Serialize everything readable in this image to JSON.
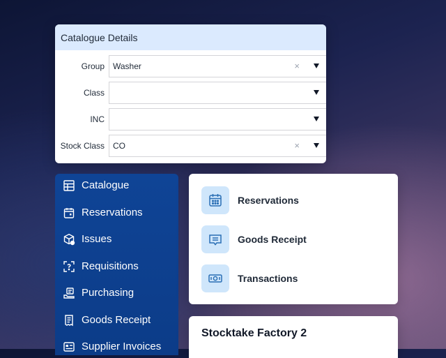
{
  "catalogue_details": {
    "title": "Catalogue Details",
    "fields": [
      {
        "label": "Group",
        "value": "Washer",
        "clearable": true
      },
      {
        "label": "Class",
        "value": "",
        "clearable": false
      },
      {
        "label": "INC",
        "value": "",
        "clearable": false
      },
      {
        "label": "Stock Class",
        "value": "CO",
        "clearable": true
      }
    ],
    "clear_glyph": "×"
  },
  "sidebar": {
    "items": [
      {
        "label": "Catalogue",
        "icon": "catalogue-icon"
      },
      {
        "label": "Reservations",
        "icon": "calendar-icon"
      },
      {
        "label": "Issues",
        "icon": "box-icon"
      },
      {
        "label": "Requisitions",
        "icon": "requisition-icon"
      },
      {
        "label": "Purchasing",
        "icon": "purchasing-icon"
      },
      {
        "label": "Goods Receipt",
        "icon": "receipt-icon"
      },
      {
        "label": "Supplier Invoices",
        "icon": "invoice-icon"
      }
    ]
  },
  "quick_links": {
    "items": [
      {
        "label": "Reservations",
        "icon": "calendar-icon"
      },
      {
        "label": "Goods Receipt",
        "icon": "receipt-icon"
      },
      {
        "label": "Transactions",
        "icon": "money-icon"
      }
    ]
  },
  "stocktake": {
    "title": "Stocktake Factory 2"
  },
  "colors": {
    "sidebar_bg": "#0f4496",
    "header_bg": "#dbeafe",
    "icon_bg": "#cfe6fb",
    "icon_blue": "#2a6fb5"
  }
}
